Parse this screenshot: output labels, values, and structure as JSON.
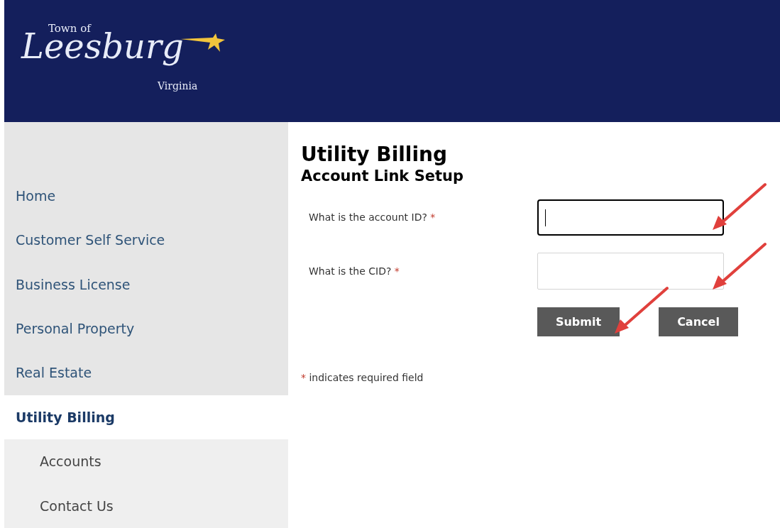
{
  "logo": {
    "top": "Town of",
    "script": "Leesburg",
    "bottom": "Virginia"
  },
  "sidebar": {
    "items": [
      {
        "label": "Home",
        "selected": false
      },
      {
        "label": "Customer Self Service",
        "selected": false
      },
      {
        "label": "Business License",
        "selected": false
      },
      {
        "label": "Personal Property",
        "selected": false
      },
      {
        "label": "Real Estate",
        "selected": false
      },
      {
        "label": "Utility Billing",
        "selected": true,
        "children": [
          {
            "label": "Accounts",
            "selected": false
          },
          {
            "label": "Contact Us",
            "selected": false
          }
        ]
      }
    ]
  },
  "page": {
    "title": "Utility Billing",
    "subtitle": "Account Link Setup"
  },
  "form": {
    "fields": [
      {
        "label": "What is the account ID?",
        "required_mark": "*",
        "focused": true
      },
      {
        "label": "What is the CID?",
        "required_mark": "*",
        "focused": false
      }
    ],
    "buttons": [
      "Submit",
      "Cancel"
    ],
    "note": {
      "mark": "*",
      "text": "indicates required field"
    }
  }
}
